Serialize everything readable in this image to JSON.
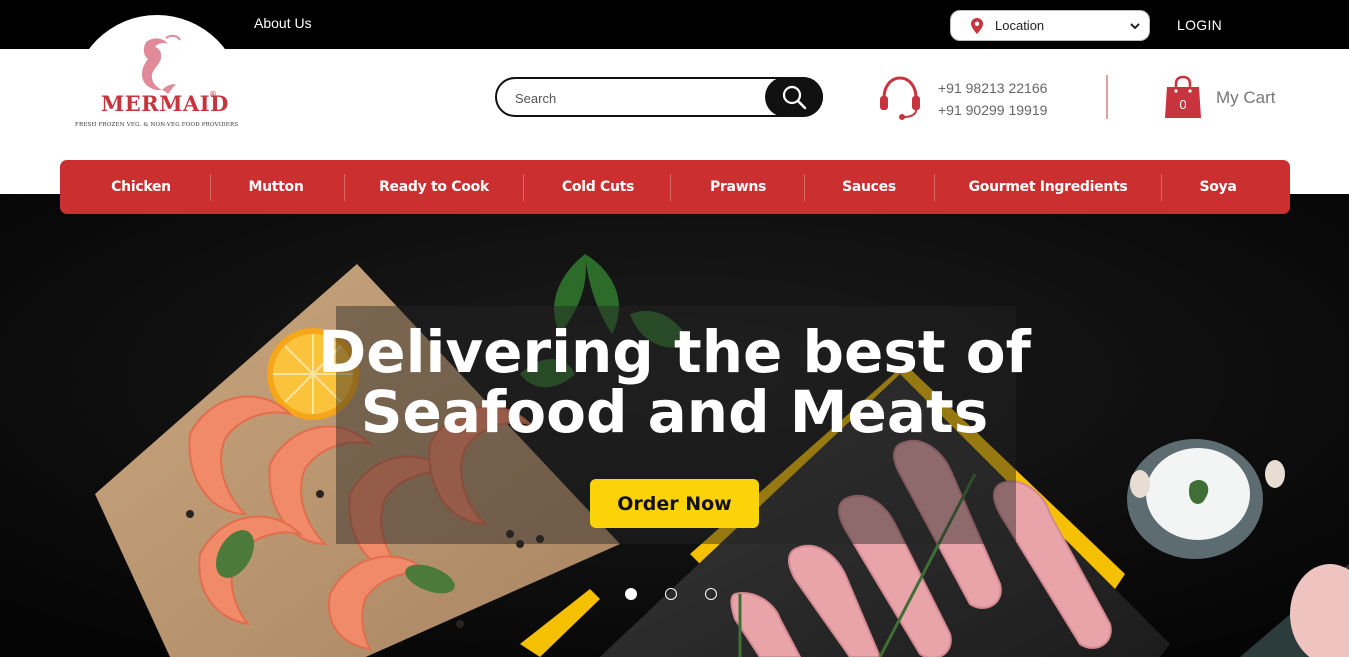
{
  "topbar": {
    "about_label": "About Us",
    "location_value": "Location",
    "login_label": "LOGIN"
  },
  "logo": {
    "name": "MERMAID",
    "tagline": "FRESH FROZEN VEG. & NON-VEG FOOD PROVIDERS",
    "brand_color": "#c7343e"
  },
  "search": {
    "placeholder": "Search"
  },
  "contact": {
    "phone1": "+91 98213 22166",
    "phone2": "+91 90299 19919"
  },
  "cart": {
    "count": "0",
    "label": "My Cart"
  },
  "nav": {
    "items": [
      {
        "label": "Chicken"
      },
      {
        "label": "Mutton"
      },
      {
        "label": "Ready to Cook"
      },
      {
        "label": "Cold Cuts"
      },
      {
        "label": "Prawns"
      },
      {
        "label": "Sauces"
      },
      {
        "label": "Gourmet Ingredients"
      },
      {
        "label": "Soya"
      }
    ],
    "color": "#cb2f2f"
  },
  "hero": {
    "headline_line1": "Delivering the best of",
    "headline_line2": "Seafood and Meats",
    "cta_label": "Order Now",
    "cta_color": "#fcd209",
    "slide_count": 3,
    "active_slide": 1
  }
}
